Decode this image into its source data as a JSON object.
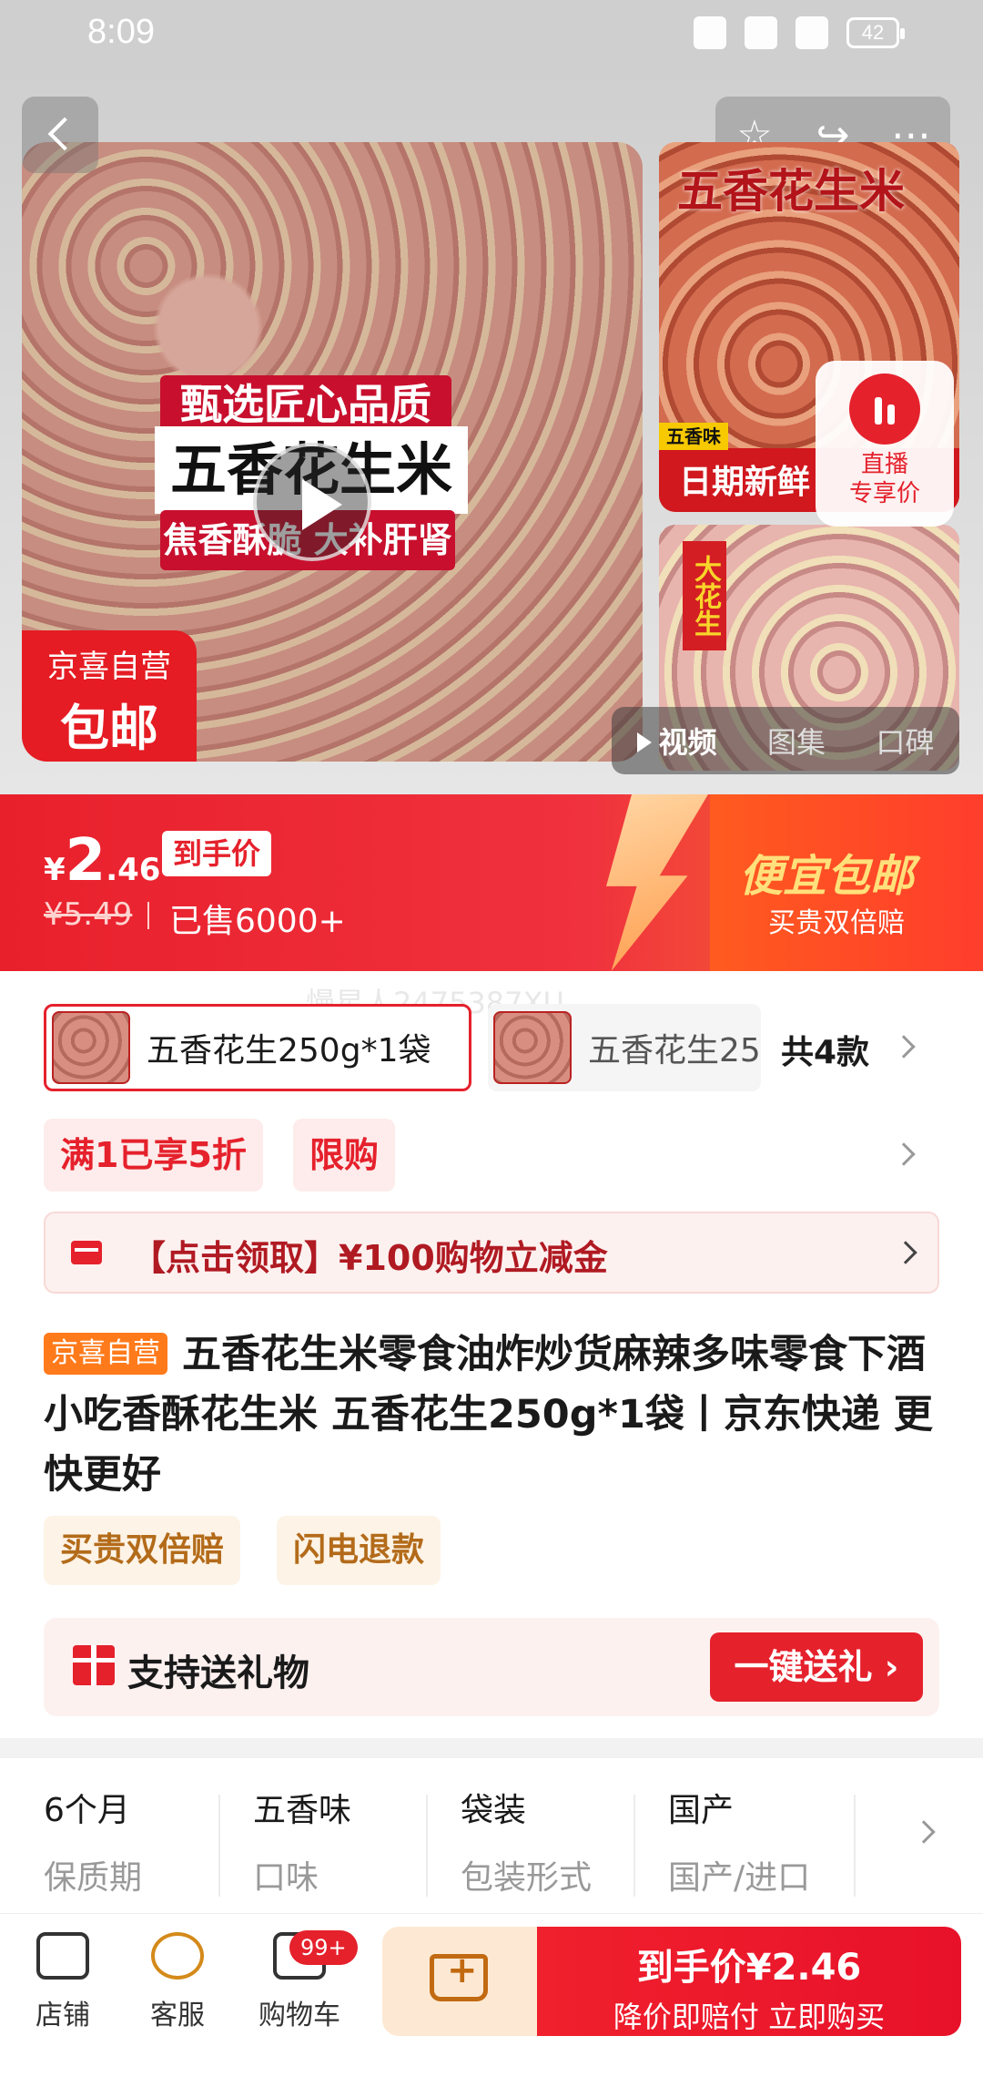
{
  "status_bar": {
    "time": "8:09",
    "battery": "42"
  },
  "gallery": {
    "banner_line1": "甄选匠心品质",
    "banner_line2": "五香花生米",
    "banner_line3": "焦香酥脆 大补肝肾",
    "badge_line1": "京喜自营",
    "badge_line2": "包邮",
    "thumb1_title": "五香花生米",
    "thumb1_tag": "日期新鲜",
    "thumb1_small": "五香味",
    "thumb2_label": "大花生",
    "live_line1": "直播",
    "live_line2": "专享价",
    "tabs": [
      "视频",
      "图集",
      "口碑"
    ]
  },
  "price": {
    "currency": "¥",
    "integer": "2",
    "decimal": ".46",
    "tag": "到手价",
    "original": "¥5.49",
    "sold": "已售6000+",
    "promo_title": "便宜包邮",
    "promo_sub": "买贵双倍赔"
  },
  "watermark": "慢星人2475387XU",
  "variants": {
    "selected": "五香花生250g*1袋",
    "other": "五香花生25",
    "count": "共4款"
  },
  "promos": [
    "满1已享5折",
    "限购"
  ],
  "coupon": "【点击领取】¥100购物立减金",
  "product": {
    "badge": "京喜自营",
    "title": "五香花生米零食油炸炒货麻辣多味零食下酒小吃香酥花生米 五香花生250g*1袋丨京东快递 更快更好"
  },
  "services": [
    "买贵双倍赔",
    "闪电退款"
  ],
  "gift": {
    "label": "支持送礼物",
    "button": "一键送礼 ›"
  },
  "specs": [
    {
      "value": "6个月",
      "key": "保质期"
    },
    {
      "value": "五香味",
      "key": "口味"
    },
    {
      "value": "袋装",
      "key": "包装形式"
    },
    {
      "value": "国产",
      "key": "国产/进口"
    }
  ],
  "bottom_nav": {
    "shop": "店铺",
    "service": "客服",
    "cart": "购物车",
    "cart_badge": "99+",
    "buy_line1": "到手价¥2.46",
    "buy_line2": "降价即赔付 立即购买"
  },
  "colors": {
    "brand_red": "#e5212c",
    "accent_orange": "#ff7a1a",
    "promo_yellow": "#ffe07a"
  }
}
